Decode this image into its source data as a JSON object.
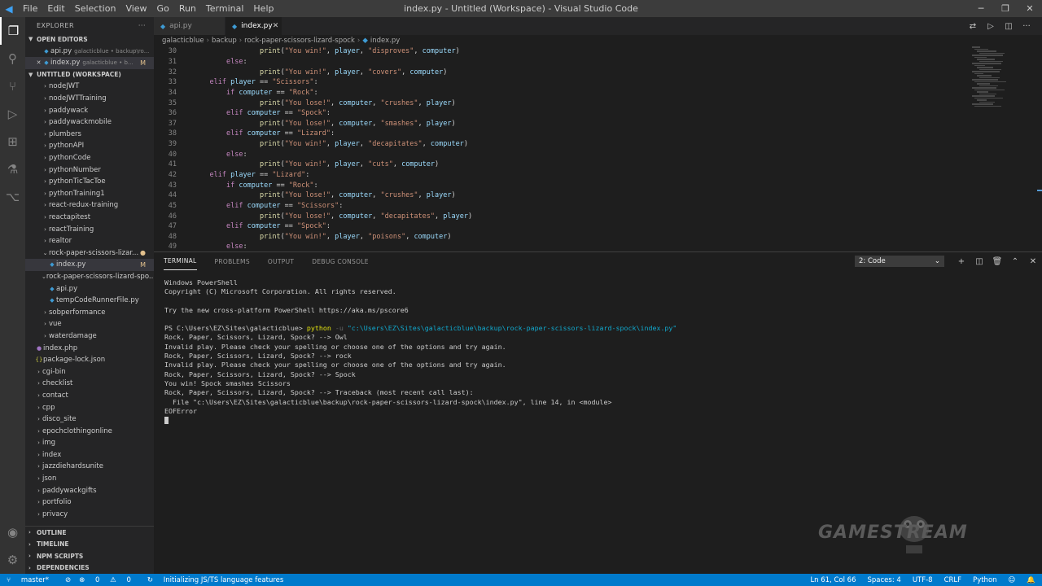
{
  "titlebar": {
    "menu": [
      "File",
      "Edit",
      "Selection",
      "View",
      "Go",
      "Run",
      "Terminal",
      "Help"
    ],
    "title": "index.py - Untitled (Workspace) - Visual Studio Code"
  },
  "sidebar": {
    "header": "EXPLORER",
    "open_editors_label": "OPEN EDITORS",
    "open_editors": [
      {
        "name": "api.py",
        "desc": "galacticblue • backup\\ro...",
        "badge": ""
      },
      {
        "name": "index.py",
        "desc": "galacticblue • b...",
        "badge": "M"
      }
    ],
    "workspace_label": "UNTITLED (WORKSPACE)",
    "tree": [
      {
        "name": "nodeJWT",
        "type": "folder",
        "level": 1
      },
      {
        "name": "nodeJWTTraining",
        "type": "folder",
        "level": 1
      },
      {
        "name": "paddywack",
        "type": "folder",
        "level": 1
      },
      {
        "name": "paddywackmobile",
        "type": "folder",
        "level": 1
      },
      {
        "name": "plumbers",
        "type": "folder",
        "level": 1
      },
      {
        "name": "pythonAPI",
        "type": "folder",
        "level": 1
      },
      {
        "name": "pythonCode",
        "type": "folder",
        "level": 1
      },
      {
        "name": "pythonNumber",
        "type": "folder",
        "level": 1
      },
      {
        "name": "pythonTicTacToe",
        "type": "folder",
        "level": 1
      },
      {
        "name": "pythonTraining1",
        "type": "folder",
        "level": 1
      },
      {
        "name": "react-redux-training",
        "type": "folder",
        "level": 1
      },
      {
        "name": "reactapitest",
        "type": "folder",
        "level": 1
      },
      {
        "name": "reactTraining",
        "type": "folder",
        "level": 1
      },
      {
        "name": "realtor",
        "type": "folder",
        "level": 1
      },
      {
        "name": "rock-paper-scissors-lizar...",
        "type": "folder-open",
        "level": 1,
        "badge": "●"
      },
      {
        "name": "index.py",
        "type": "py",
        "level": 2,
        "badge": "M",
        "selected": true
      },
      {
        "name": "rock-paper-scissors-lizard-spo...",
        "type": "folder-open",
        "level": 1
      },
      {
        "name": "api.py",
        "type": "py",
        "level": 2
      },
      {
        "name": "tempCodeRunnerFile.py",
        "type": "py",
        "level": 2
      },
      {
        "name": "sobperformance",
        "type": "folder",
        "level": 1
      },
      {
        "name": "vue",
        "type": "folder",
        "level": 1
      },
      {
        "name": "waterdamage",
        "type": "folder",
        "level": 1
      },
      {
        "name": "index.php",
        "type": "php",
        "level": 0
      },
      {
        "name": "package-lock.json",
        "type": "json",
        "level": 0
      },
      {
        "name": "cgi-bin",
        "type": "folder",
        "level": 0
      },
      {
        "name": "checklist",
        "type": "folder",
        "level": 0
      },
      {
        "name": "contact",
        "type": "folder",
        "level": 0
      },
      {
        "name": "cpp",
        "type": "folder",
        "level": 0
      },
      {
        "name": "disco_site",
        "type": "folder",
        "level": 0
      },
      {
        "name": "epochclothingonline",
        "type": "folder",
        "level": 0
      },
      {
        "name": "img",
        "type": "folder",
        "level": 0
      },
      {
        "name": "index",
        "type": "folder",
        "level": 0
      },
      {
        "name": "jazzdiehardsunite",
        "type": "folder",
        "level": 0
      },
      {
        "name": "json",
        "type": "folder",
        "level": 0
      },
      {
        "name": "paddywackgifts",
        "type": "folder",
        "level": 0
      },
      {
        "name": "portfolio",
        "type": "folder",
        "level": 0
      },
      {
        "name": "privacy",
        "type": "folder",
        "level": 0
      }
    ],
    "bottom_sections": [
      "OUTLINE",
      "TIMELINE",
      "NPM SCRIPTS",
      "DEPENDENCIES"
    ]
  },
  "tabs": [
    {
      "name": "api.py",
      "active": false
    },
    {
      "name": "index.py",
      "active": true
    }
  ],
  "breadcrumb": [
    "galacticblue",
    "backup",
    "rock-paper-scissors-lizard-spock",
    "index.py"
  ],
  "editor": {
    "lines": [
      {
        "n": "30",
        "indent": 4,
        "text": "print(\"You win!\", player, \"disproves\", computer)"
      },
      {
        "n": "31",
        "indent": 2,
        "text": "else:"
      },
      {
        "n": "32",
        "indent": 4,
        "text": "print(\"You win!\", player, \"covers\", computer)"
      },
      {
        "n": "33",
        "indent": 1,
        "text": "elif player == \"Scissors\":"
      },
      {
        "n": "34",
        "indent": 2,
        "text": "if computer == \"Rock\":"
      },
      {
        "n": "35",
        "indent": 4,
        "text": "print(\"You lose!\", computer, \"crushes\", player)"
      },
      {
        "n": "36",
        "indent": 2,
        "text": "elif computer == \"Spock\":"
      },
      {
        "n": "37",
        "indent": 4,
        "text": "print(\"You lose!\", computer, \"smashes\", player)"
      },
      {
        "n": "38",
        "indent": 2,
        "text": "elif computer == \"Lizard\":"
      },
      {
        "n": "39",
        "indent": 4,
        "text": "print(\"You win!\", player, \"decapitates\", computer)"
      },
      {
        "n": "40",
        "indent": 2,
        "text": "else:"
      },
      {
        "n": "41",
        "indent": 4,
        "text": "print(\"You win!\", player, \"cuts\", computer)"
      },
      {
        "n": "42",
        "indent": 1,
        "text": "elif player == \"Lizard\":"
      },
      {
        "n": "43",
        "indent": 2,
        "text": "if computer == \"Rock\":"
      },
      {
        "n": "44",
        "indent": 4,
        "text": "print(\"You lose!\", computer, \"crushes\", player)"
      },
      {
        "n": "45",
        "indent": 2,
        "text": "elif computer == \"Scissors\":"
      },
      {
        "n": "46",
        "indent": 4,
        "text": "print(\"You lose!\", computer, \"decapitates\", player)"
      },
      {
        "n": "47",
        "indent": 2,
        "text": "elif computer == \"Spock\":"
      },
      {
        "n": "48",
        "indent": 4,
        "text": "print(\"You win!\", player, \"poisons\", computer)"
      },
      {
        "n": "49",
        "indent": 2,
        "text": "else:"
      }
    ]
  },
  "panel": {
    "tabs": [
      "TERMINAL",
      "PROBLEMS",
      "OUTPUT",
      "DEBUG CONSOLE"
    ],
    "active_tab": "TERMINAL",
    "terminal_select": "2: Code",
    "terminal_lines": [
      {
        "text": "Windows PowerShell"
      },
      {
        "text": "Copyright (C) Microsoft Corporation. All rights reserved."
      },
      {
        "text": ""
      },
      {
        "text": "Try the new cross-platform PowerShell https://aka.ms/pscore6"
      },
      {
        "text": ""
      },
      {
        "text": "PS C:\\Users\\EZ\\Sites\\galacticblue> ",
        "cmd": "python",
        "flag": " -u ",
        "arg": "\"c:\\Users\\EZ\\Sites\\galacticblue\\backup\\rock-paper-scissors-lizard-spock\\index.py\""
      },
      {
        "text": "Rock, Paper, Scissors, Lizard, Spock? --> Owl"
      },
      {
        "text": "Invalid play. Please check your spelling or choose one of the options and try again."
      },
      {
        "text": "Rock, Paper, Scissors, Lizard, Spock? --> rock"
      },
      {
        "text": "Invalid play. Please check your spelling or choose one of the options and try again."
      },
      {
        "text": "Rock, Paper, Scissors, Lizard, Spock? --> Spock"
      },
      {
        "text": "You win! Spock smashes Scissors"
      },
      {
        "text": "Rock, Paper, Scissors, Lizard, Spock? --> Traceback (most recent call last):"
      },
      {
        "text": "  File \"c:\\Users\\EZ\\Sites\\galacticblue\\backup\\rock-paper-scissors-lizard-spock\\index.py\", line 14, in <module>"
      },
      {
        "text": "EOFError"
      }
    ]
  },
  "watermark": "GAMESTREAM",
  "status": {
    "branch": "master*",
    "sync": "⊘",
    "errors": "0",
    "warnings": "0",
    "message": "Initializing JS/TS language features",
    "position": "Ln 61, Col 66",
    "spaces": "Spaces: 4",
    "encoding": "UTF-8",
    "eol": "CRLF",
    "language": "Python"
  }
}
